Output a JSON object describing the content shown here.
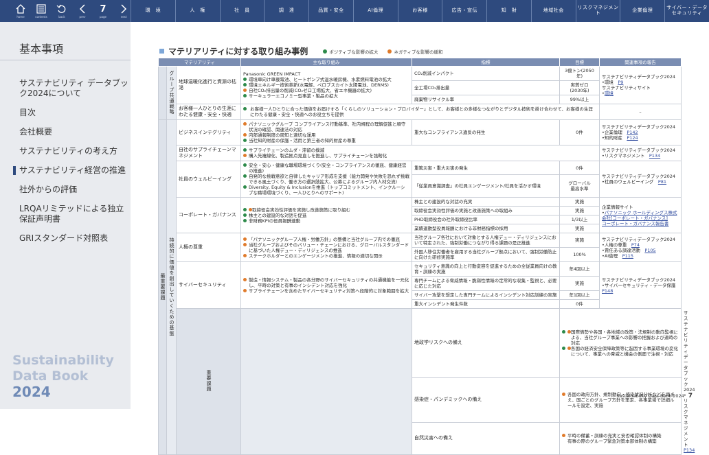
{
  "nav": {
    "buttons": [
      {
        "label": "home",
        "icon": "home-icon"
      },
      {
        "label": "contents",
        "icon": "contents-icon"
      },
      {
        "label": "back",
        "icon": "back-icon"
      },
      {
        "label": "prev",
        "icon": "prev-icon"
      },
      {
        "label": "page",
        "value": "7"
      },
      {
        "label": "next",
        "icon": "next-icon"
      }
    ],
    "categories": [
      "環　境",
      "人　権",
      "社　員",
      "調　達",
      "品質・安全",
      "AI倫理",
      "お客様",
      "広告・宣伝",
      "知　財",
      "地域社会",
      "リスクマネジメント",
      "企業倫理",
      "サイバー・データ\nセキュリティ"
    ]
  },
  "sidebar": {
    "title": "基本事項",
    "items": [
      "サステナビリティ データブック2024について",
      "目次",
      "会社概要",
      "サステナビリティの考え方",
      "サステナビリティ経営の推進",
      "社外からの評価",
      "LRQAリミテッドによる独立保証声明書",
      "GRIスタンダード対照表"
    ],
    "current_index": 4,
    "brand": [
      "Sustainability",
      "Data Book",
      "2024"
    ]
  },
  "content": {
    "heading": "マテリアリティに対する取り組み事例",
    "legend": {
      "positive": "ポジティブな影響の拡大",
      "negative": "ネガティブな影響の緩和",
      "positive_color": "#2d8a4a",
      "negative_color": "#e07b2b"
    },
    "headers": [
      "マテリアリティ",
      "主な取り組み",
      "指標",
      "目標",
      "関連事項の報告"
    ],
    "groups": {
      "group_strategy": "グループ共通戦略",
      "top_priority": "最重要課題",
      "foundation": "持続的に価値を創出していくための基盤",
      "important": "重要課題"
    },
    "rows": {
      "r1": {
        "materiality": "地球温暖化進行と資源の枯渇",
        "actions_title": "Panasonic GREEN IMPACT",
        "actions": [
          {
            "type": "g",
            "text": "環境車向け車載電池、ヒートポンプ式温水暖房機、水素燃料電池の拡大"
          },
          {
            "type": "g",
            "text": "環境エネルギー技術革新(水電解、ペロブスカイト太陽電池、DERMS)"
          },
          {
            "type": "o",
            "text": "自社CO₂排出量の削減(CO₂ゼロ工場拡大、省エネ機器の拡大)"
          },
          {
            "type": "g",
            "text": "サーキュラーエコノミー型事業・製品の拡大"
          }
        ],
        "indicators": [
          "CO₂削減インパクト",
          "全工場CO₂排出量",
          "廃棄物リサイクル率"
        ],
        "targets": [
          "3億トン(2050年)",
          "実質ゼロ\n(2030年)",
          "99%以上"
        ],
        "reports": [
          {
            "text": "サステナビリティデータブック2024"
          },
          {
            "text": "•環境　"
          },
          {
            "text": "P9",
            "link": true
          },
          {
            "text": "サステナビリティサイト"
          },
          {
            "text": "•"
          },
          {
            "text": "環境",
            "link": true
          }
        ]
      },
      "r2": {
        "materiality": "お客様一人ひとりの生涯にわたる健康・安全・快適",
        "action": "お客様一人ひとりに合った価値をお届けする「くらしのソリューション・プロバイダー」として、お客様との多様なつながりとデジタル技術を掛け合わせて、お客様の生涯にわたる健康・安全・快適へのお役立ちを提供",
        "report": "–"
      },
      "r3": {
        "materiality": "ビジネスインテグリティ",
        "actions": [
          {
            "type": "o",
            "text": "パナソニックグループ コンプライアンス行動基準、社内規程の理解促進と順守状況の確認、関連法の対応"
          },
          {
            "type": "o",
            "text": "内部通報制度の周知と適切な運用"
          },
          {
            "type": "g",
            "text": "当社知的財産の保護・活用と第三者の知的財産の尊重"
          }
        ],
        "indicator": "重大なコンプライアンス違反の発生",
        "target": "0件",
        "reports": [
          "サステナビリティデータブック2024",
          "•企業倫理　",
          "P142",
          "•知的財産　",
          "P124"
        ]
      },
      "r4": {
        "materiality": "自社のサプライチェーンマネジメント",
        "actions": [
          {
            "type": "g",
            "text": "サプライチェーンのムダ・滞留の撲滅"
          },
          {
            "type": "o",
            "text": "購入先複線化、製造拠点見直しを推進し、サプライチェーンを強靭化"
          }
        ],
        "reports": [
          "サステナビリティデータブック2024",
          "•リスクマネジメント　",
          "P134"
        ]
      },
      "r5": {
        "materiality": "社員のウェルビーイング",
        "actions": [
          {
            "type": "g",
            "text": "安全・安心・健康な職場環境づくり(安全・コンプライアンスの徹底、健康経営の推進)"
          },
          {
            "type": "g",
            "text": "自発的な挑戦意欲と自律したキャリア形成を支援（能力開発や失敗を恐れず挑戦できる風土づくり、働き方の選択肢拡大、公募によるグループ内人材交流)"
          },
          {
            "type": "g",
            "text": "Diversity, Equity & Inclusionを推進（トップコミットメント、インクルーシブな職場環境づくり、一人ひとりへのサポート)"
          }
        ],
        "indicators": [
          "重篤災害・重大災害の発生",
          "「従業員意識調査」の社員エンゲージメント/社員を活かす環境"
        ],
        "targets": [
          "0件",
          "グローバル\n最高水準"
        ],
        "reports": [
          "サステナビリティデータブック2024",
          "•社員のウェルビーイング　",
          "P81"
        ]
      },
      "r6": {
        "materiality": "コーポレート・ガバナンス",
        "actions": [
          {
            "type": "go",
            "text": "取締役会実効性評価を実施し改善施策に取り組む"
          },
          {
            "type": "g",
            "text": "株主との建設的な対話を促進"
          },
          {
            "type": "g",
            "text": "非財務KPIの役員報酬連動"
          }
        ],
        "indicators": [
          "株主との建設的な対話の充実",
          "取締役会実効性評価の実施と改善施策への取組み",
          "PHD取締役会の社外取締役比率",
          "業績連動型役員報酬における非財務指標の採用"
        ],
        "targets": [
          "実施",
          "実施",
          "1/3以上",
          "実施"
        ],
        "reports": [
          "企業情報サイト",
          "•",
          "パナソニック ホールディングス株式会社[コーポレート・ガバナンス]",
          "コーポレート・ガバナンス報告書"
        ]
      },
      "r7": {
        "materiality": "人権の尊重",
        "actions": [
          {
            "type": "o",
            "text": "「パナソニックグループ人権・労働方針」の整備と当社グループ内での徹底"
          },
          {
            "type": "o",
            "text": "当社グループおよびそのバリュー・チェーンにおける、グローバルスタンダードに基づいた人権デュー・ディリジェンスの推進"
          },
          {
            "type": "o",
            "text": "ステークホルダーとのエンゲージメントの推進、情報の適切な開示"
          }
        ],
        "indicators": [
          "当社グループ各社において対象とする人権デュー・ディリジェンスにおいて特定された、強制労働につながり得る課題の是正推進",
          "外国人移住労働者を雇用する当社グループ拠点において、強制労働防止に向けた研修実施率"
        ],
        "targets": [
          "実施",
          "100%"
        ],
        "reports": [
          "サステナビリティデータブック2024",
          "•人権の尊重　",
          "P74",
          "•責任ある調達活動　",
          "P105",
          "•AI倫理　",
          "P115"
        ]
      },
      "r8": {
        "materiality": "サイバーセキュリティ",
        "actions": [
          {
            "type": "o",
            "text": "製造・情報システム・製品の各分野のサイバーセキュリティの共通機能を一元化し、平時の対策と有事のインシデント対応を強化"
          },
          {
            "type": "o",
            "text": "サプライチェーンを含めたサイバーセキュリティ対策へ段階的に対象範囲を拡大"
          }
        ],
        "indicators": [
          "セキュリティ意識の向上と行動変容を促進するための全従業員向けの教育・訓練の実施",
          "専門チームによる脅威情報・脆弱性情報の定常的な収集・監視と、必要に応じた対応",
          "サイバー攻撃を想定した専門チームによるインシデント対応訓練の実施",
          "重大インシデント発生件数"
        ],
        "targets": [
          "年4回以上",
          "実施",
          "年1回以上",
          "0件"
        ],
        "reports": [
          "サステナビリティデータブック2024",
          "•サイバーセキュリティ・データ保護　",
          "P148"
        ]
      },
      "r9": {
        "materiality": "地政学リスクへの備え",
        "actions": [
          {
            "type": "go",
            "text": "国際情勢や各国・各地域の政策・法規制の動向監視による、当社グループ事業への影響の把握および適時の対応"
          },
          {
            "type": "go",
            "text": "各国の経済安全保障政策等に起因する事業環境の変化について、事業への脅威と機会の側面で注視・対応"
          }
        ]
      },
      "r10": {
        "materiality": "感染症・パンデミックへの備え",
        "actions": [
          {
            "type": "o",
            "text": "各国の政府方針、規制動向・感染状況分析などを踏まえ、国ごとのグループ方針を策定、各事業場で詳細ルールを設定、実施"
          }
        ]
      },
      "r11": {
        "materiality": "自然災害への備え",
        "actions": [
          {
            "type": "o",
            "text": "平時の備蓄・訓練の充実と安否確認体制の構築"
          },
          {
            "type": "n",
            "text": "有事の際のグループ緊急対策本部体制の構築"
          }
        ]
      },
      "r9_11_reports": [
        "サステナビリティデータブック2024",
        "•リスクマネジメント　",
        "P134"
      ]
    },
    "footer": {
      "title": "Sustainability Data Book 2024",
      "page": "7"
    }
  }
}
